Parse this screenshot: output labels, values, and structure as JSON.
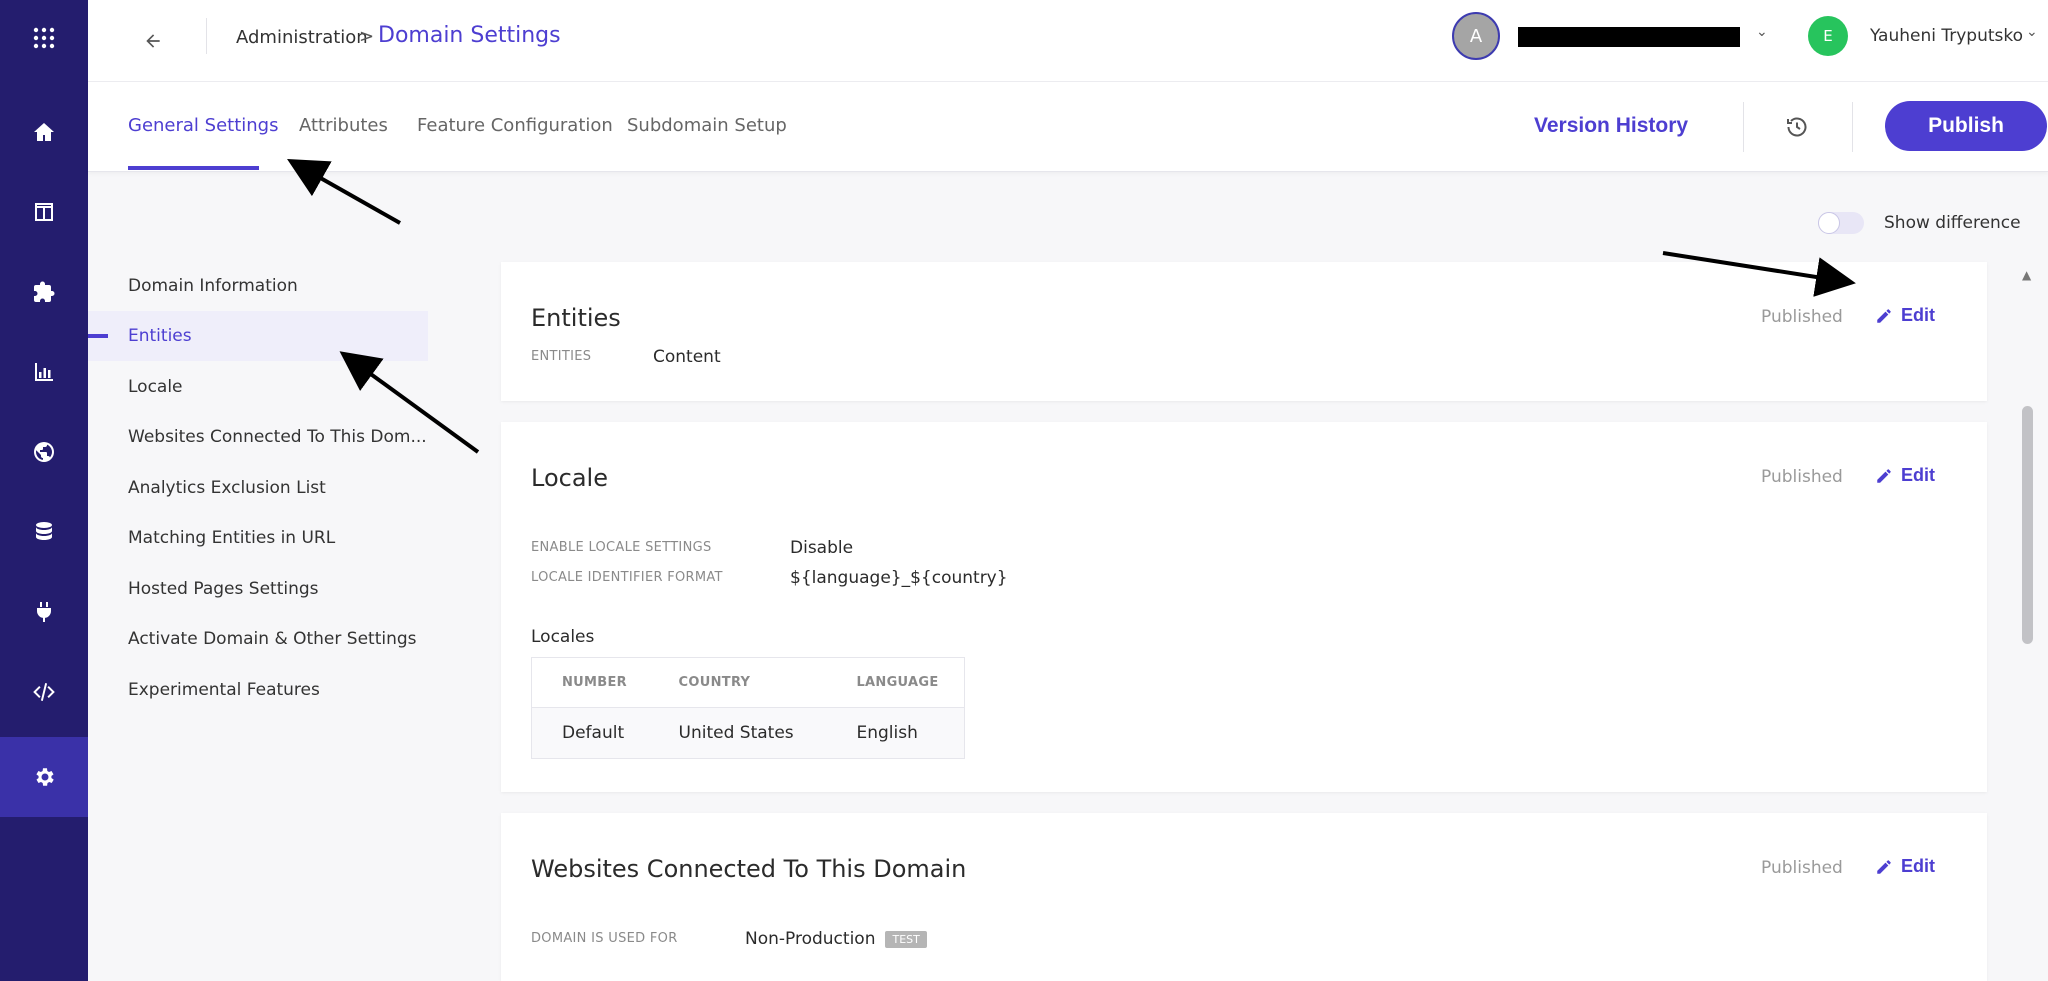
{
  "rail": {
    "items": [
      {
        "icon": "grid-icon"
      },
      {
        "icon": "home-icon"
      },
      {
        "icon": "layout-icon"
      },
      {
        "icon": "puzzle-icon"
      },
      {
        "icon": "bar-chart-icon"
      },
      {
        "icon": "globe-icon"
      },
      {
        "icon": "database-icon"
      },
      {
        "icon": "plug-icon"
      },
      {
        "icon": "code-icon"
      },
      {
        "icon": "gear-icon",
        "active": true
      }
    ]
  },
  "header": {
    "breadcrumb_parent": "Administration",
    "breadcrumb_separator": ">",
    "breadcrumb_current": "Domain Settings",
    "org_avatar_letter": "A",
    "user_avatar_letter": "E",
    "user_name": "Yauheni Tryputsko"
  },
  "tabs": {
    "items": [
      "General Settings",
      "Attributes",
      "Feature Configuration",
      "Subdomain Setup"
    ],
    "active": "General Settings",
    "version_history": "Version History",
    "publish": "Publish"
  },
  "show_difference": {
    "label": "Show difference",
    "enabled": false
  },
  "sidenav": {
    "items": [
      "Domain Information",
      "Entities",
      "Locale",
      "Websites Connected To This Dom...",
      "Analytics Exclusion List",
      "Matching Entities in URL",
      "Hosted Pages Settings",
      "Activate Domain & Other Settings",
      "Experimental Features"
    ],
    "active": "Entities"
  },
  "cards": {
    "entities": {
      "title": "Entities",
      "status": "Published",
      "edit": "Edit",
      "fields": [
        {
          "label": "ENTITIES",
          "value": "Content"
        }
      ]
    },
    "locale": {
      "title": "Locale",
      "status": "Published",
      "edit": "Edit",
      "fields": [
        {
          "label": "ENABLE LOCALE SETTINGS",
          "value": "Disable"
        },
        {
          "label": "LOCALE IDENTIFIER FORMAT",
          "value": "${language}_${country}"
        }
      ],
      "locales_title": "Locales",
      "table": {
        "headers": [
          "NUMBER",
          "COUNTRY",
          "LANGUAGE"
        ],
        "rows": [
          [
            "Default",
            "United States",
            "English"
          ]
        ]
      }
    },
    "websites": {
      "title": "Websites Connected To This Domain",
      "status": "Published",
      "edit": "Edit",
      "fields": [
        {
          "label": "DOMAIN IS USED FOR",
          "value": "Non-Production",
          "badge": "TEST"
        }
      ]
    }
  },
  "colors": {
    "rail_bg": "#241d6e",
    "accent": "#4d3ed1",
    "user_avatar": "#27c45d"
  }
}
